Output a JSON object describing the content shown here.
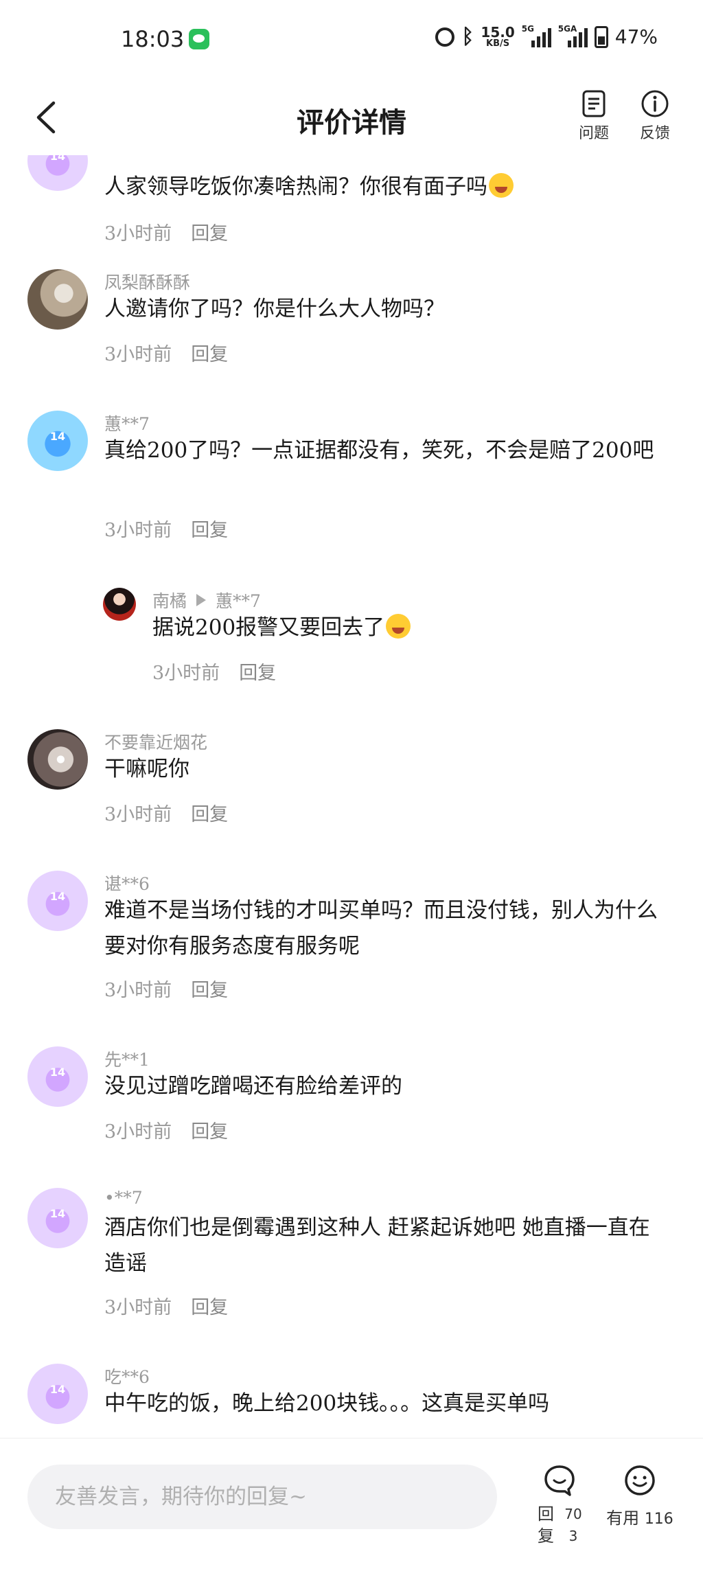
{
  "status_bar": {
    "time": "18:03",
    "net_speed_value": "15.0",
    "net_speed_unit": "KB/S",
    "signal1_label": "5G",
    "signal2_label": "5GA",
    "battery": "47%"
  },
  "header": {
    "title": "评价详情",
    "question_label": "问题",
    "feedback_label": "反馈"
  },
  "comments": [
    {
      "user": "",
      "text": "人家领导吃饭你凑啥热闹？你很有面子吗",
      "emoji": "rofl-emoji",
      "time": "3小时前",
      "reply": "回复"
    },
    {
      "user": "凤梨酥酥酥",
      "text": "人邀请你了吗？你是什么大人物吗？",
      "time": "3小时前",
      "reply": "回复"
    },
    {
      "user": "蕙**7",
      "text": "真给200了吗？一点证据都没有，笑死，不会是赔了200吧",
      "time": "3小时前",
      "reply": "回复"
    },
    {
      "user": "南橘",
      "reply_to": "蕙**7",
      "text": "据说200报警又要回去了",
      "emoji": "joy-emoji",
      "time": "3小时前",
      "reply": "回复"
    },
    {
      "user": "不要靠近烟花",
      "text": "干嘛呢你",
      "time": "3小时前",
      "reply": "回复"
    },
    {
      "user": "谌**6",
      "text": "难道不是当场付钱的才叫买单吗？而且没付钱，别人为什么要对你有服务态度有服务呢",
      "time": "3小时前",
      "reply": "回复"
    },
    {
      "user": "先**1",
      "text": "没见过蹭吃蹭喝还有脸给差评的",
      "time": "3小时前",
      "reply": "回复"
    },
    {
      "user": "•**7",
      "text": "酒店你们也是倒霉遇到这种人 赶紧起诉她吧 她直播一直在造谣",
      "time": "3小时前",
      "reply": "回复"
    },
    {
      "user": "吃**6",
      "text": "中午吃的饭，晚上给200块钱。。。这真是买单吗"
    }
  ],
  "bottom_bar": {
    "input_placeholder": "友善发言，期待你的回复~",
    "reply_label": "回复",
    "reply_count": "703",
    "useful_label": "有用",
    "useful_count": "116"
  }
}
